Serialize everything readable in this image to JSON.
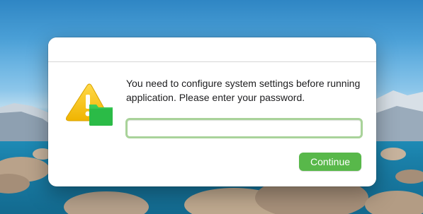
{
  "dialog": {
    "message": "You need to configure system settings before running application. Please enter your password.",
    "password_value": "",
    "continue_label": "Continue",
    "icon": "warning-folder-icon"
  },
  "colors": {
    "button_green": "#58b84a",
    "field_focus_ring": "#a9d39a",
    "warning_yellow": "#f4c21b"
  }
}
